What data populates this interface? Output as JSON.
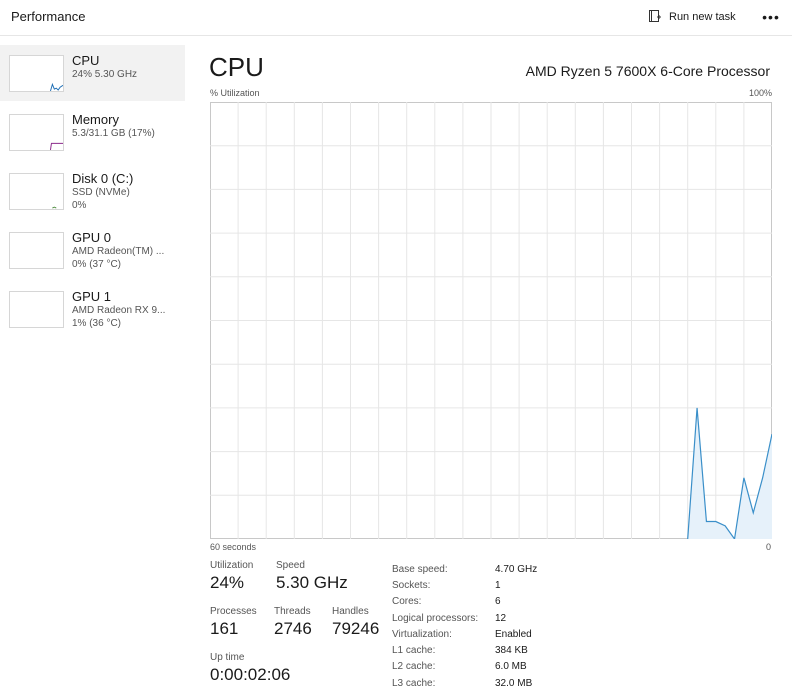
{
  "topbar": {
    "title": "Performance",
    "run_task_label": "Run new task",
    "more_label": "•••"
  },
  "sidebar": {
    "items": [
      {
        "name": "CPU",
        "line1": "24%  5.30 GHz",
        "line2": "",
        "color": "#1f6fb5"
      },
      {
        "name": "Memory",
        "line1": "5.3/31.1 GB (17%)",
        "line2": "",
        "color": "#8b2a8b"
      },
      {
        "name": "Disk 0 (C:)",
        "line1": "SSD (NVMe)",
        "line2": "0%",
        "color": "#4a8a3a"
      },
      {
        "name": "GPU 0",
        "line1": "AMD Radeon(TM) ...",
        "line2": "0%  (37 °C)",
        "color": "#8a5a1a"
      },
      {
        "name": "GPU 1",
        "line1": "AMD Radeon RX 9...",
        "line2": "1%  (36 °C)",
        "color": "#8a5a1a"
      }
    ]
  },
  "main": {
    "title": "CPU",
    "processor": "AMD Ryzen 5 7600X 6-Core Processor",
    "y_label": "% Utilization",
    "y_max_label": "100%",
    "x_left_label": "60 seconds",
    "x_right_label": "0"
  },
  "chart_data": {
    "type": "area",
    "x_label": "60 seconds",
    "y_label": "% Utilization",
    "ylim": [
      0,
      100
    ],
    "xlim": [
      60,
      0
    ],
    "grid": true,
    "line_color": "#3a8fc9",
    "fill_color": "#e6f1fa",
    "x": [
      9,
      8,
      7,
      6,
      5,
      4,
      3,
      2,
      1,
      0
    ],
    "values": [
      0,
      30,
      4,
      4,
      3,
      0,
      14,
      6,
      14,
      24
    ]
  },
  "stats": {
    "utilization": {
      "label": "Utilization",
      "value": "24%"
    },
    "speed": {
      "label": "Speed",
      "value": "5.30 GHz"
    },
    "processes": {
      "label": "Processes",
      "value": "161"
    },
    "threads": {
      "label": "Threads",
      "value": "2746"
    },
    "handles": {
      "label": "Handles",
      "value": "79246"
    },
    "uptime": {
      "label": "Up time",
      "value": "0:00:02:06"
    }
  },
  "specs": [
    {
      "key": "Base speed:",
      "value": "4.70 GHz"
    },
    {
      "key": "Sockets:",
      "value": "1"
    },
    {
      "key": "Cores:",
      "value": "6"
    },
    {
      "key": "Logical processors:",
      "value": "12"
    },
    {
      "key": "Virtualization:",
      "value": "Enabled"
    },
    {
      "key": "L1 cache:",
      "value": "384 KB"
    },
    {
      "key": "L2 cache:",
      "value": "6.0 MB"
    },
    {
      "key": "L3 cache:",
      "value": "32.0 MB"
    }
  ]
}
